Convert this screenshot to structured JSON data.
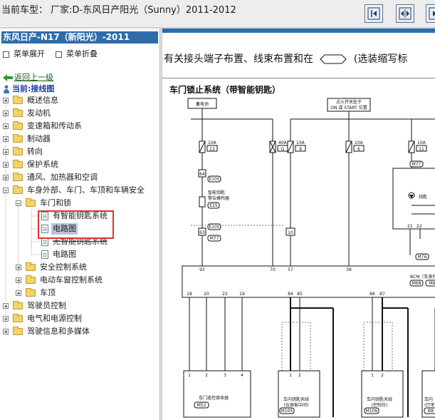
{
  "topbar": {
    "car_title": "当前车型：  厂家:D-东风日产阳光（Sunny）2011-2012",
    "buttons": [
      "prev-page",
      "fit-width",
      "next-page"
    ]
  },
  "sidebar": {
    "header": "东风日产-N17（新阳光）-2011",
    "expand_all": "菜单展开",
    "collapse_all": "菜单折叠",
    "back_link": "返回上一级",
    "current": "当前:接线图",
    "tree": [
      {
        "label": "概述信息",
        "level": 0,
        "type": "folder",
        "expanded": false
      },
      {
        "label": "发动机",
        "level": 0,
        "type": "folder",
        "expanded": false
      },
      {
        "label": "变速箱和传动系",
        "level": 0,
        "type": "folder",
        "expanded": false
      },
      {
        "label": "制动器",
        "level": 0,
        "type": "folder",
        "expanded": false
      },
      {
        "label": "转向",
        "level": 0,
        "type": "folder",
        "expanded": false
      },
      {
        "label": "保护系统",
        "level": 0,
        "type": "folder",
        "expanded": false
      },
      {
        "label": "通风、加热器和空调",
        "level": 0,
        "type": "folder",
        "expanded": false
      },
      {
        "label": "车身外部、车门、车顶和车辆安全",
        "level": 0,
        "type": "folder",
        "expanded": true
      },
      {
        "label": "车门和锁",
        "level": 1,
        "type": "folder",
        "expanded": true
      },
      {
        "label": "有智能钥匙系统",
        "level": 2,
        "type": "doc"
      },
      {
        "label": "电路图",
        "level": 2,
        "type": "doc",
        "selected": true
      },
      {
        "label": "无智能钥匙系统",
        "level": 2,
        "type": "doc"
      },
      {
        "label": "电路图",
        "level": 2,
        "type": "doc"
      },
      {
        "label": "安全控制系统",
        "level": 1,
        "type": "folder",
        "expanded": false
      },
      {
        "label": "电动车窗控制系统",
        "level": 1,
        "type": "folder",
        "expanded": false
      },
      {
        "label": "车顶",
        "level": 1,
        "type": "folder",
        "expanded": false
      },
      {
        "label": "驾驶员控制",
        "level": 0,
        "type": "folder",
        "expanded": false
      },
      {
        "label": "电气和电源控制",
        "level": 0,
        "type": "folder",
        "expanded": false
      },
      {
        "label": "驾驶信息和多媒体",
        "level": 0,
        "type": "folder",
        "expanded": false
      }
    ]
  },
  "content": {
    "note_pre": "有关接头端子布置、线束布置和在",
    "note_post": "(选装缩写标",
    "diagram_title": "车门锁止系统（带智能钥匙）",
    "labels": {
      "battery": "蓄电池",
      "ign_switch_1": "点火开关处于",
      "ign_switch_2": "ON 或 START 位置",
      "f1_amp": "10A",
      "f1_id": "13",
      "f2_amp": "40A",
      "f2_id": "G",
      "f3_amp": "10A",
      "f3_id": "9",
      "f4_amp": "10A",
      "f4_id": "6",
      "f5_amp": "10A",
      "f5_id": "11",
      "c64": "64",
      "e105a": "E105",
      "buzzer_1": "智能钥匙",
      "buzzer_2": "警告蜂鸣器",
      "e25": "E25",
      "e105b": "E105",
      "c63": "63",
      "m77a": "M77",
      "c10": "10",
      "m77b": "M77",
      "key": "钥匙",
      "m76": "M76",
      "c21": "21",
      "c22": "22",
      "pin93": "93",
      "pin70": "70",
      "pin57": "57",
      "pin38": "38",
      "bcm": "BCM（车身控",
      "m68": "M68",
      "m6x": "M6",
      "b18": "18",
      "b20": "20",
      "b22": "22",
      "b19": "19",
      "b84": "84",
      "b85": "85",
      "b86": "86",
      "b87": "87",
      "r1": "1",
      "r2": "2",
      "r3": "3",
      "r4": "4",
      "a1a": "1",
      "a2a": "2",
      "a1b": "1",
      "a2b": "2",
      "remote_recv": "车门遥控接收器",
      "m52": "M52",
      "ant1_1": "车内钥匙天线",
      "ant1_2": "(仪表板中间)",
      "m105": "M105",
      "ant2_1": "车内钥匙天线",
      "ant2_2": "(控制台)",
      "m106": "M106",
      "ant3_1": "车内",
      "ant3_2": "(行李",
      "b8": "B8"
    }
  },
  "colors": {
    "header_blue": "#2e6dab",
    "highlight_red": "#e53030",
    "back_green": "#1a5c1a",
    "folder_yellow": "#f3d36b"
  }
}
